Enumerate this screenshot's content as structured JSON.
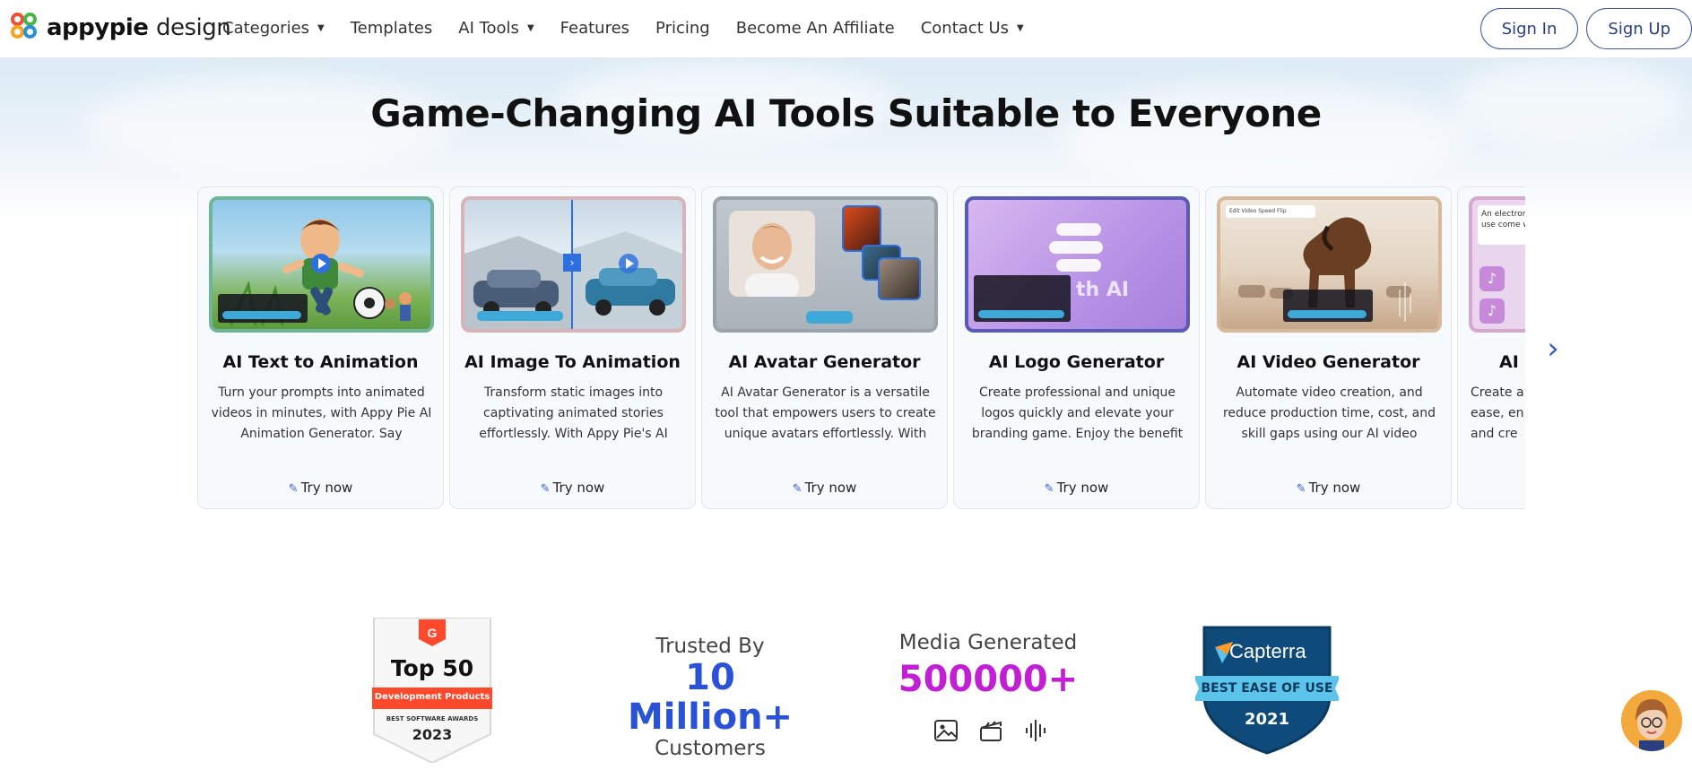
{
  "brand": {
    "name_bold": "appypie",
    "name_light": "design"
  },
  "nav": {
    "items": [
      {
        "label": "Categories",
        "dropdown": true
      },
      {
        "label": "Templates",
        "dropdown": false
      },
      {
        "label": "AI Tools",
        "dropdown": true
      },
      {
        "label": "Features",
        "dropdown": false
      },
      {
        "label": "Pricing",
        "dropdown": false
      },
      {
        "label": "Become An Affiliate",
        "dropdown": false
      },
      {
        "label": "Contact Us",
        "dropdown": true
      }
    ],
    "sign_in": "Sign In",
    "sign_up": "Sign Up"
  },
  "headline": "Game-Changing AI Tools Suitable to Everyone",
  "cards": [
    {
      "title": "AI Text to Animation",
      "desc": "Turn your prompts into animated videos in minutes, with Appy Pie AI Animation Generator. Say goodbye...",
      "cta": "Try now"
    },
    {
      "title": "AI Image To Animation",
      "desc": "Transform static images into captivating animated stories effortlessly. With Appy Pie's AI Imag...",
      "cta": "Try now"
    },
    {
      "title": "AI Avatar Generator",
      "desc": "AI Avatar Generator is a versatile tool that empowers users to create unique avatars effortlessly. With a...",
      "cta": "Try now"
    },
    {
      "title": "AI Logo Generator",
      "desc": "Create professional and unique logos quickly and elevate your branding game. Enjoy the benefit o...",
      "cta": "Try now"
    },
    {
      "title": "AI Video Generator",
      "desc": "Automate video creation, and reduce production time, cost, and skill gaps using our AI video maker...",
      "cta": "Try now"
    },
    {
      "title": "AI M",
      "desc": "Create a ease, en and cre",
      "cta": ""
    }
  ],
  "thumb_text": {
    "logo_word": "th AI",
    "next_card_text": "An electronic where we use come when s",
    "video_toolbar": "Edit Video   Speed   Flip"
  },
  "stats": {
    "g2": {
      "top": "Top 50",
      "ribbon": "Development Products",
      "sub": "BEST SOFTWARE AWARDS",
      "year": "2023"
    },
    "trusted_top": "Trusted By",
    "trusted_big": "10 Million+",
    "trusted_bottom": "Customers",
    "media_top": "Media Generated",
    "media_big": "500000+",
    "capterra": {
      "name": "Capterra",
      "ribbon": "BEST EASE OF USE",
      "year": "2021"
    }
  },
  "colors": {
    "accent_blue": "#2a52d6",
    "media_purple": "#c21ed6",
    "nav_border": "#3a56a8"
  }
}
